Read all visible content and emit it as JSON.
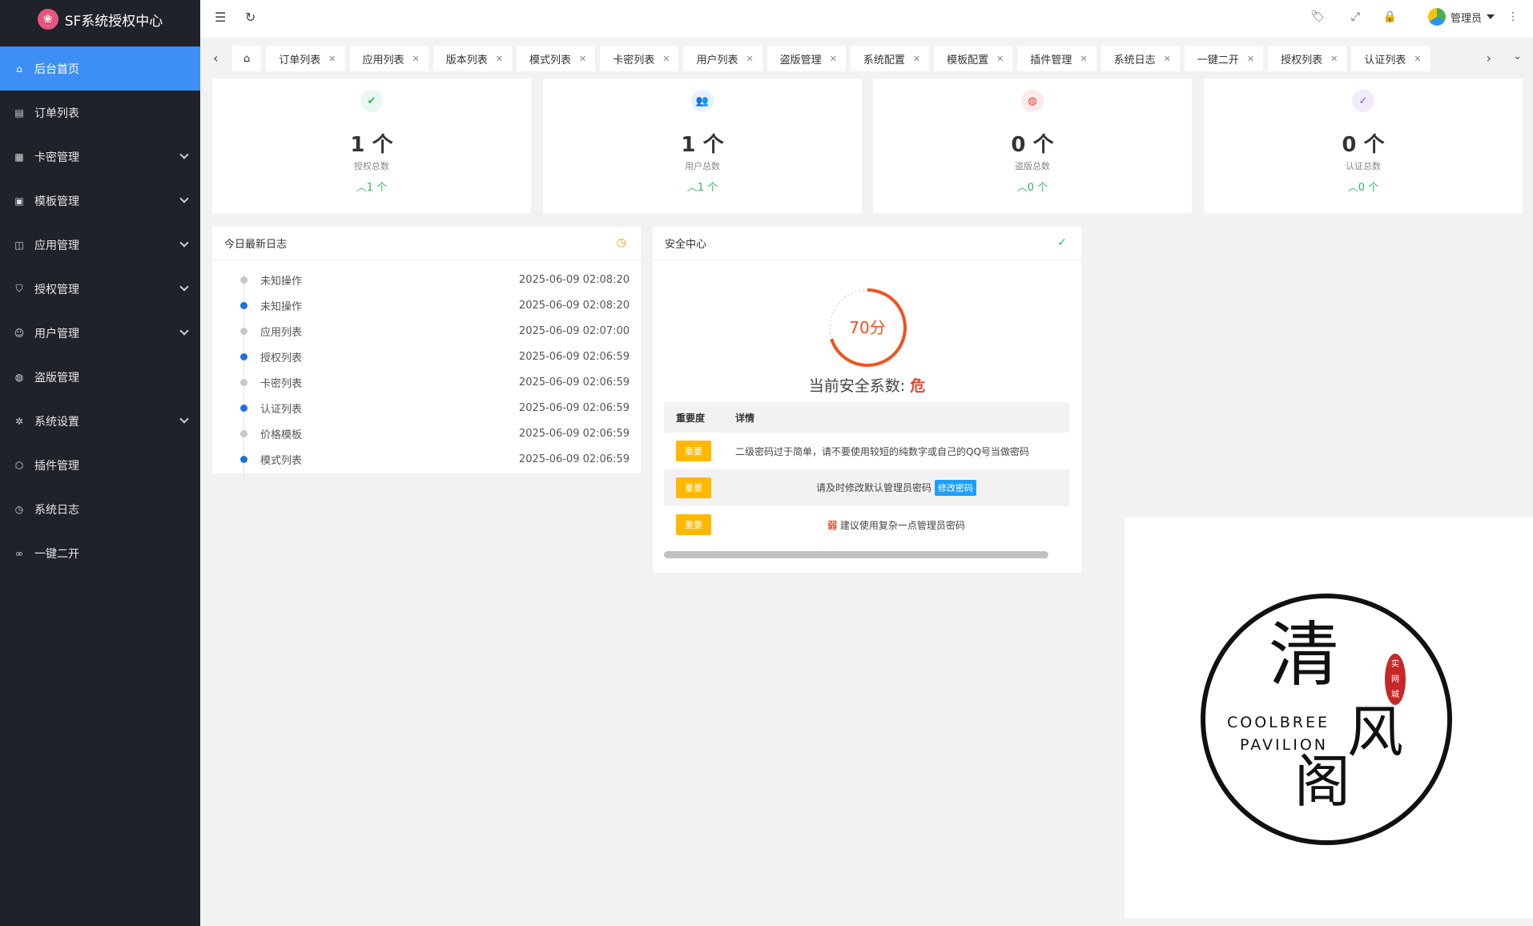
{
  "app": {
    "title": "SF系统授权中心"
  },
  "sidebar": {
    "items": [
      {
        "label": "后台首页",
        "icon": "home-icon",
        "active": true,
        "expandable": false
      },
      {
        "label": "订单列表",
        "icon": "document-icon",
        "expandable": false
      },
      {
        "label": "卡密管理",
        "icon": "grid-icon",
        "expandable": true
      },
      {
        "label": "模板管理",
        "icon": "template-icon",
        "expandable": true
      },
      {
        "label": "应用管理",
        "icon": "apps-icon",
        "expandable": true
      },
      {
        "label": "授权管理",
        "icon": "shield-icon",
        "expandable": true
      },
      {
        "label": "用户管理",
        "icon": "user-icon",
        "expandable": true
      },
      {
        "label": "盗版管理",
        "icon": "globe-icon",
        "expandable": false
      },
      {
        "label": "系统设置",
        "icon": "gear-icon",
        "expandable": true
      },
      {
        "label": "插件管理",
        "icon": "box-icon",
        "expandable": false
      },
      {
        "label": "系统日志",
        "icon": "clock-icon",
        "expandable": false
      },
      {
        "label": "一键二开",
        "icon": "infinity-icon",
        "expandable": false
      }
    ]
  },
  "header": {
    "user_name": "管理员"
  },
  "tabs": [
    "订单列表",
    "应用列表",
    "版本列表",
    "模式列表",
    "卡密列表",
    "用户列表",
    "盗版管理",
    "系统配置",
    "模板配置",
    "插件管理",
    "系统日志",
    "一键二开",
    "授权列表",
    "认证列表"
  ],
  "stats": [
    {
      "value": "1 个",
      "label": "授权总数",
      "delta": "1 个",
      "icon": "shield-check-icon",
      "color": "#2eb85c",
      "bg": "#e9f8ee"
    },
    {
      "value": "1 个",
      "label": "用户总数",
      "delta": "1 个",
      "icon": "users-icon",
      "color": "#1e88e5",
      "bg": "#e6f1fd"
    },
    {
      "value": "0 个",
      "label": "盗版总数",
      "delta": "0 个",
      "icon": "globe-icon",
      "color": "#e53935",
      "bg": "#fdeaea"
    },
    {
      "value": "0 个",
      "label": "认证总数",
      "delta": "0 个",
      "icon": "check-circle-icon",
      "color": "#7e57c2",
      "bg": "#f1ebfb"
    }
  ],
  "logs": {
    "title": "今日最新日志",
    "items": [
      {
        "name": "未知操作",
        "time": "2025-06-09 02:08:20",
        "highlight": false
      },
      {
        "name": "未知操作",
        "time": "2025-06-09 02:08:20",
        "highlight": true
      },
      {
        "name": "应用列表",
        "time": "2025-06-09 02:07:00",
        "highlight": false
      },
      {
        "name": "授权列表",
        "time": "2025-06-09 02:06:59",
        "highlight": true
      },
      {
        "name": "卡密列表",
        "time": "2025-06-09 02:06:59",
        "highlight": false
      },
      {
        "name": "认证列表",
        "time": "2025-06-09 02:06:59",
        "highlight": true
      },
      {
        "name": "价格模板",
        "time": "2025-06-09 02:06:59",
        "highlight": false
      },
      {
        "name": "模式列表",
        "time": "2025-06-09 02:06:59",
        "highlight": true
      }
    ]
  },
  "security": {
    "title": "安全中心",
    "score": "70分",
    "score_fraction": 0.7,
    "level_prefix": "当前安全系数:",
    "level": "危",
    "col_level": "重要度",
    "col_detail": "详情",
    "rows": [
      {
        "badge": "重要",
        "detail": "二级密码过于简单，请不要使用较短的纯数字或自己的QQ号当做密码"
      },
      {
        "badge": "重要",
        "detail": "请及时修改默认管理员密码",
        "action": "修改密码"
      },
      {
        "badge": "重要",
        "weak": "弱",
        "detail": "建议使用复杂一点管理员密码"
      }
    ]
  },
  "watermark": {
    "big_chars": [
      "清",
      "风",
      "阁"
    ],
    "en_line1": "COOLBREE",
    "en_line2": "PAVILION",
    "seal_chars": [
      "实",
      "网",
      "城"
    ]
  }
}
